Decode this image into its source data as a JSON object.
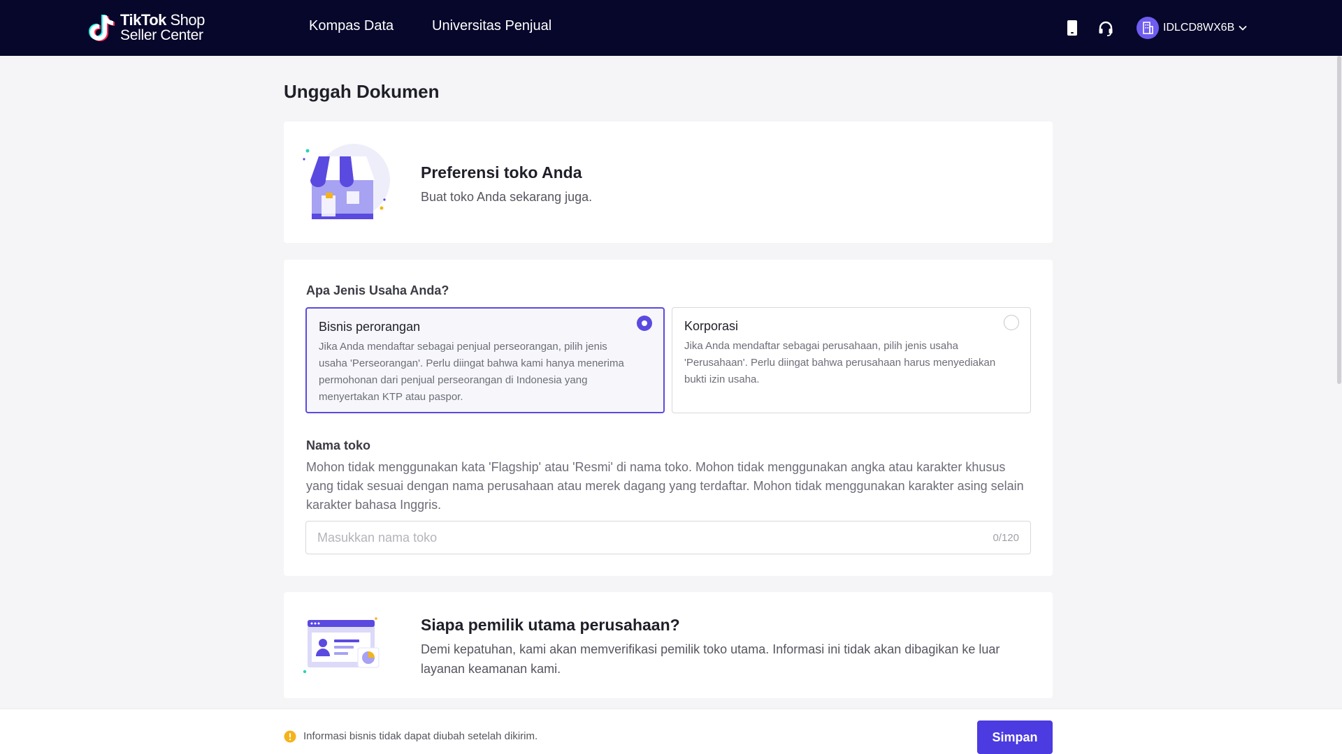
{
  "header": {
    "logo_line1_bold": "TikTok",
    "logo_line1_rest": " Shop",
    "logo_line2": "Seller Center",
    "nav": [
      {
        "label": "Kompas Data"
      },
      {
        "label": "Universitas Penjual"
      }
    ],
    "icons": [
      "phone-icon",
      "headset-icon"
    ],
    "account_id": "IDLCD8WX6B"
  },
  "page": {
    "title": "Unggah Dokumen"
  },
  "store_card": {
    "title": "Preferensi toko Anda",
    "subtitle": "Buat toko Anda sekarang juga."
  },
  "business": {
    "question": "Apa Jenis Usaha Anda?",
    "options": [
      {
        "title": "Bisnis perorangan",
        "desc": "Jika Anda mendaftar sebagai penjual perseorangan, pilih jenis usaha 'Perseorangan'. Perlu diingat bahwa kami hanya menerima permohonan dari penjual perseorangan di Indonesia yang menyertakan KTP atau paspor.",
        "selected": true
      },
      {
        "title": "Korporasi",
        "desc": "Jika Anda mendaftar sebagai perusahaan, pilih jenis usaha 'Perusahaan'. Perlu diingat bahwa perusahaan harus menyediakan bukti izin usaha.",
        "selected": false
      }
    ],
    "store_name_label": "Nama toko",
    "store_name_help": "Mohon tidak menggunakan kata 'Flagship' atau 'Resmi' di nama toko. Mohon tidak menggunakan angka atau karakter khusus yang tidak sesuai dengan nama perusahaan atau merek dagang yang terdaftar. Mohon tidak menggunakan karakter asing selain karakter bahasa Inggris.",
    "store_name_placeholder": "Masukkan nama toko",
    "store_name_value": "",
    "store_name_counter": "0/120"
  },
  "owner_card": {
    "title": "Siapa pemilik utama perusahaan?",
    "subtitle": "Demi kepatuhan, kami akan memverifikasi pemilik toko utama. Informasi ini tidak akan dibagikan ke luar layanan keamanan kami."
  },
  "footer": {
    "note": "Informasi bisnis tidak dapat diubah setelah dikirim.",
    "save_label": "Simpan"
  },
  "colors": {
    "header_bg": "#07072b",
    "accent": "#4c3be0",
    "warning": "#f5b31a"
  }
}
